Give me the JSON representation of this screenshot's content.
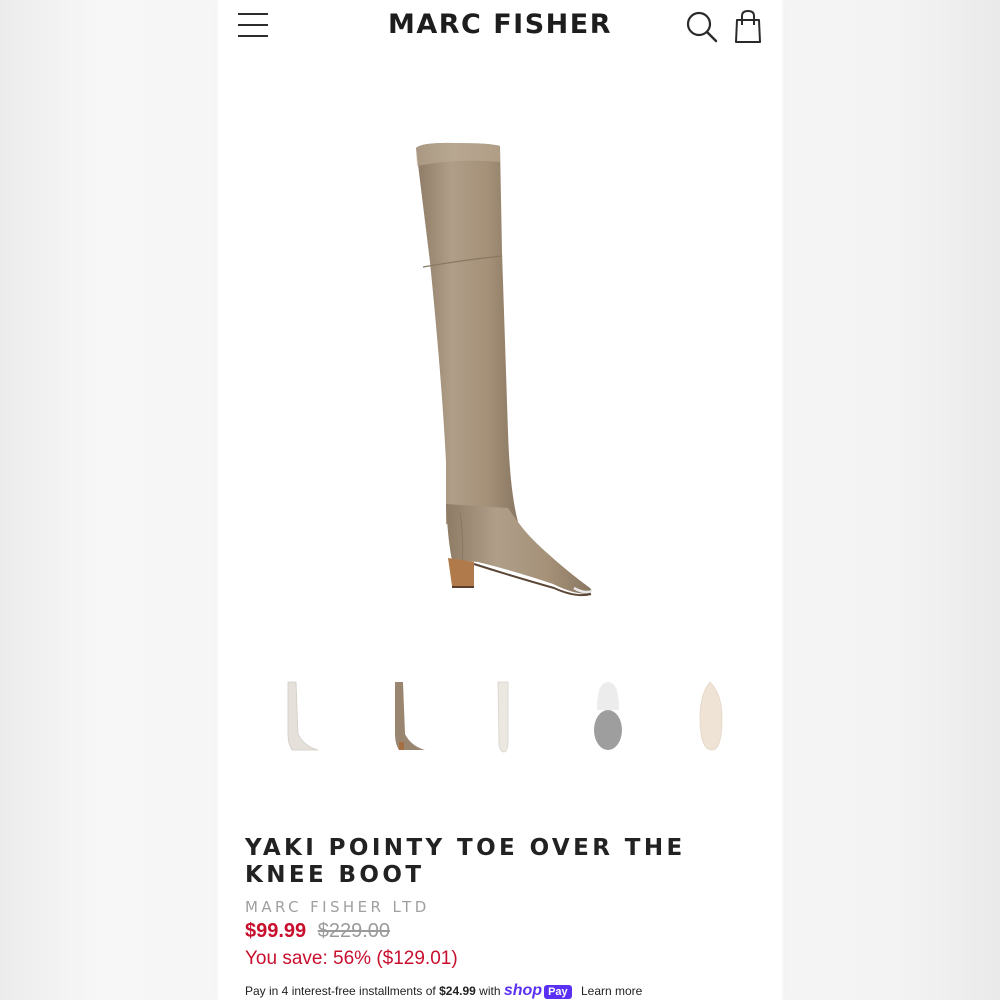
{
  "header": {
    "logo": "MARC FISHER",
    "menu_icon": "hamburger-menu-icon",
    "search_icon": "search-icon",
    "cart_icon": "shopping-bag-icon"
  },
  "product": {
    "title": "YAKI POINTY TOE OVER THE KNEE BOOT",
    "brand": "MARC FISHER LTD",
    "sale_price": "$99.99",
    "compare_price": "$229.00",
    "savings": "You save: 56% ($129.01)",
    "hero_color": "#a89580"
  },
  "thumbnails": [
    {
      "view": "side",
      "color": "#e5e0da"
    },
    {
      "view": "side",
      "color": "#9a8670"
    },
    {
      "view": "front",
      "color": "#ebe7e1"
    },
    {
      "view": "back",
      "color": "#c9c9c9"
    },
    {
      "view": "sole",
      "color": "#efe3d6"
    }
  ],
  "installments": {
    "prefix": "Pay in 4 interest-free installments of",
    "amount": "$24.99",
    "with": "with",
    "shop_word": "shop",
    "pay_badge": "Pay",
    "learn_more": "Learn more"
  },
  "colors": {
    "sale_red": "#c8102e",
    "shop_pay_purple": "#5a31f4"
  }
}
